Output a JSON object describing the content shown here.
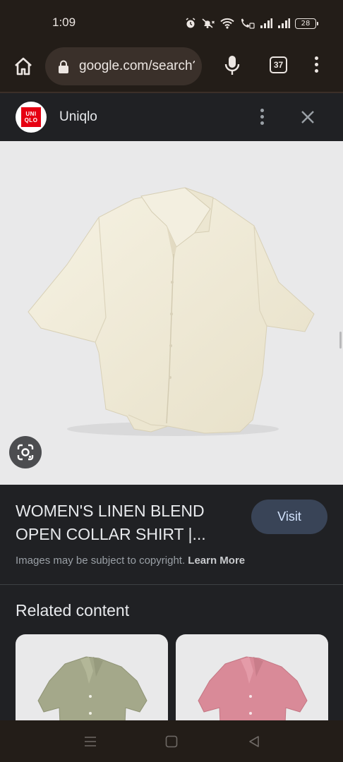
{
  "status_bar": {
    "time": "1:09",
    "battery": "28",
    "icons": [
      "alarm-icon",
      "mute-icon",
      "wifi-icon",
      "wifi-calling-icon",
      "signal-icon",
      "signal-icon-2",
      "battery-icon"
    ]
  },
  "toolbar": {
    "url": "google.com/search?",
    "tab_count": "37",
    "icons": [
      "home-icon",
      "lock-icon",
      "mic-icon",
      "tab-switcher-icon",
      "more-vert-icon"
    ]
  },
  "panel": {
    "site_name": "Uniqlo",
    "logo_text_top": "UNI",
    "logo_text_bottom": "QLO"
  },
  "product": {
    "title": "WOMEN'S LINEN BLEND OPEN COLLAR SHIRT |...",
    "visit_label": "Visit",
    "copyright_text": "Images may be subject to copyright.",
    "learn_more": "Learn More"
  },
  "related": {
    "heading": "Related content",
    "cards": [
      {
        "color": "#a4a88a"
      },
      {
        "color": "#d98a98"
      }
    ]
  },
  "colors": {
    "system_bar": "#231d18",
    "panel_bg": "#202124",
    "visit_bg": "#394457",
    "shirt_main": "#f1ecd9"
  }
}
